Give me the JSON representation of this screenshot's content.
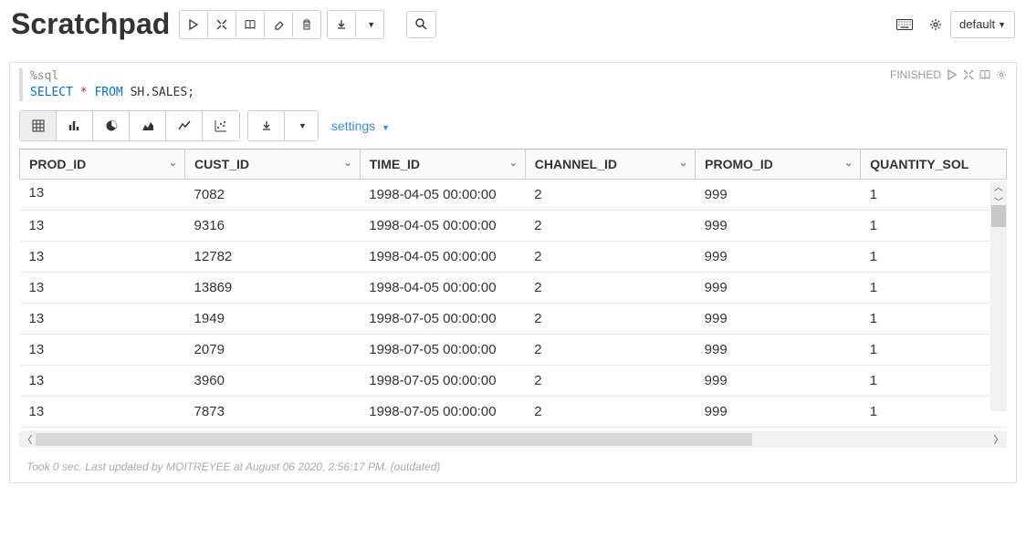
{
  "title": "Scratchpad",
  "interpreter": {
    "label": "default"
  },
  "cell": {
    "status": "FINISHED",
    "magic": "%sql",
    "sql": {
      "select": "SELECT",
      "star": "*",
      "from": "FROM",
      "table": "SH.SALES",
      "semi": ";"
    }
  },
  "settings_label": "settings",
  "columns": [
    "PROD_ID",
    "CUST_ID",
    "TIME_ID",
    "CHANNEL_ID",
    "PROMO_ID",
    "QUANTITY_SOLD"
  ],
  "rows": [
    {
      "prod_id": "13",
      "cust_id": "7082",
      "time_id": "1998-04-05 00:00:00",
      "channel_id": "2",
      "promo_id": "999",
      "quantity_sold": "1",
      "clipped": true
    },
    {
      "prod_id": "13",
      "cust_id": "9316",
      "time_id": "1998-04-05 00:00:00",
      "channel_id": "2",
      "promo_id": "999",
      "quantity_sold": "1"
    },
    {
      "prod_id": "13",
      "cust_id": "12782",
      "time_id": "1998-04-05 00:00:00",
      "channel_id": "2",
      "promo_id": "999",
      "quantity_sold": "1"
    },
    {
      "prod_id": "13",
      "cust_id": "13869",
      "time_id": "1998-04-05 00:00:00",
      "channel_id": "2",
      "promo_id": "999",
      "quantity_sold": "1"
    },
    {
      "prod_id": "13",
      "cust_id": "1949",
      "time_id": "1998-07-05 00:00:00",
      "channel_id": "2",
      "promo_id": "999",
      "quantity_sold": "1"
    },
    {
      "prod_id": "13",
      "cust_id": "2079",
      "time_id": "1998-07-05 00:00:00",
      "channel_id": "2",
      "promo_id": "999",
      "quantity_sold": "1"
    },
    {
      "prod_id": "13",
      "cust_id": "3960",
      "time_id": "1998-07-05 00:00:00",
      "channel_id": "2",
      "promo_id": "999",
      "quantity_sold": "1"
    },
    {
      "prod_id": "13",
      "cust_id": "7873",
      "time_id": "1998-07-05 00:00:00",
      "channel_id": "2",
      "promo_id": "999",
      "quantity_sold": "1"
    }
  ],
  "footer": "Took 0 sec. Last updated by MOITREYEE at August 06 2020, 2:56:17 PM. (outdated)"
}
